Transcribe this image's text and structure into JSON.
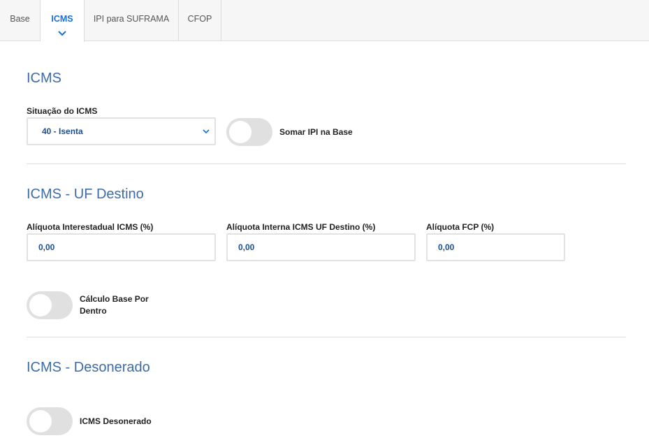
{
  "tabs": [
    {
      "label": "Base"
    },
    {
      "label": "ICMS"
    },
    {
      "label": "IPI para SUFRAMA"
    },
    {
      "label": "CFOP"
    }
  ],
  "icms": {
    "title": "ICMS",
    "situacao_label": "Situação do ICMS",
    "situacao_value": "40 - Isenta",
    "somar_ipi_label": "Somar IPI na Base",
    "somar_ipi_on": false
  },
  "uf_destino": {
    "title": "ICMS - UF Destino",
    "aliq_interestadual_label": "Alíquota Interestadual ICMS (%)",
    "aliq_interestadual_value": "0,00",
    "aliq_interna_label": "Alíquota Interna ICMS UF Destino (%)",
    "aliq_interna_value": "0,00",
    "aliq_fcp_label": "Alíquota FCP (%)",
    "aliq_fcp_value": "0,00",
    "calculo_base_label": "Cálculo Base Por Dentro",
    "calculo_base_on": false
  },
  "desonerado": {
    "title": "ICMS - Desonerado",
    "toggle_label": "ICMS Desonerado",
    "toggle_on": false
  },
  "colors": {
    "accent": "#1a6fd6",
    "heading": "#3d6ca8",
    "value": "#1f4e8c",
    "toggle_off": "#e0e0e0"
  }
}
